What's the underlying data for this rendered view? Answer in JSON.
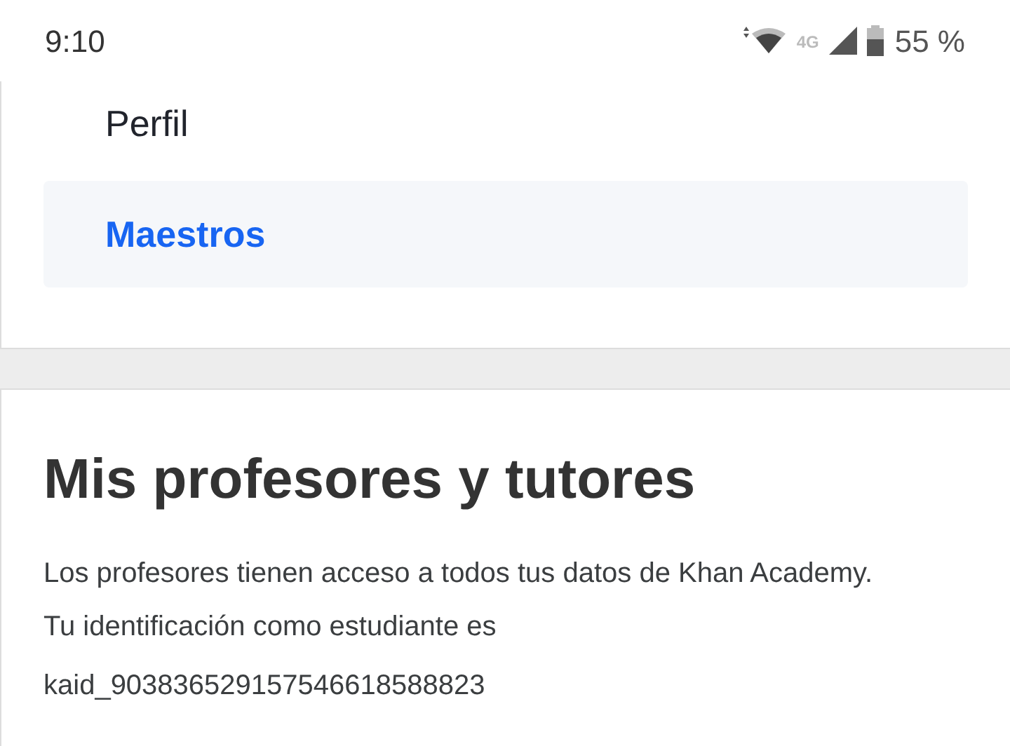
{
  "status_bar": {
    "time": "9:10",
    "network": "4G",
    "battery": "55 %"
  },
  "menu": {
    "items": [
      {
        "label": "Perfil",
        "selected": false
      },
      {
        "label": "Maestros",
        "selected": true
      }
    ]
  },
  "section": {
    "title": "Mis profesores y tutores",
    "description": "Los profesores tienen acceso a todos tus datos de Khan Academy. Tu identificación como estudiante es",
    "student_id": "kaid_903836529157546618588823"
  }
}
